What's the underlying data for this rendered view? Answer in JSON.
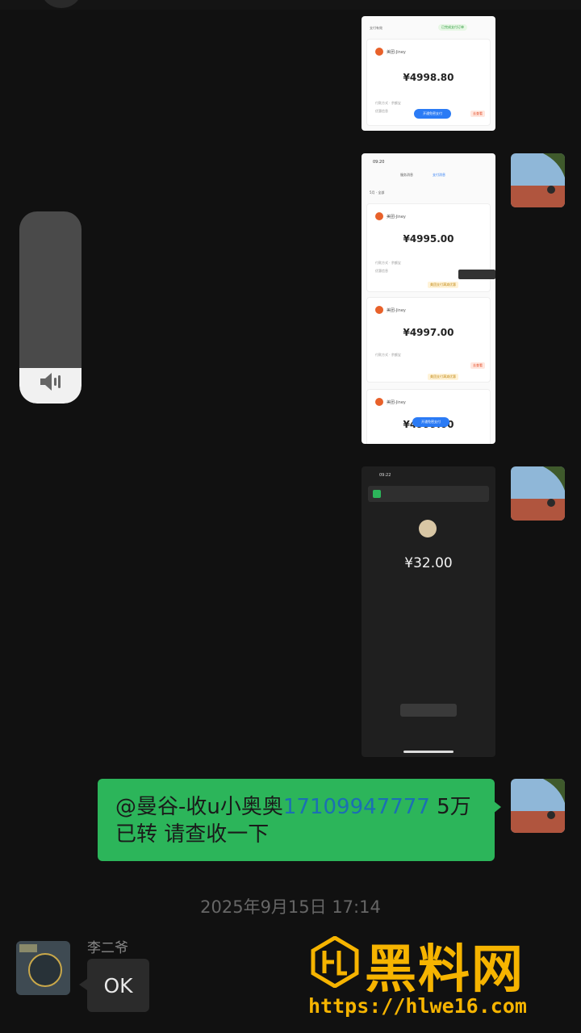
{
  "chat": {
    "payment_shots": [
      {
        "amount": "¥4998.80"
      },
      {
        "amounts": [
          "¥4995.00",
          "¥4997.00",
          "¥4999.00"
        ]
      }
    ],
    "transfer": {
      "amount": "¥32.00"
    },
    "message": {
      "mention": "@曼谷-收u小奥奥",
      "phone": "17109947777",
      "line1_tail": " 5万",
      "line2": "已转 请查收一下"
    },
    "timestamp": "2025年9月15日 17:14",
    "reply": {
      "sender": "李二爷",
      "text": "OK"
    }
  },
  "watermark": {
    "brand": "黑料网",
    "url": "https://hlwe16.com"
  },
  "colors": {
    "bubble": "#2cb55a",
    "accent": "#f6b400",
    "link": "#1b6fb3"
  }
}
